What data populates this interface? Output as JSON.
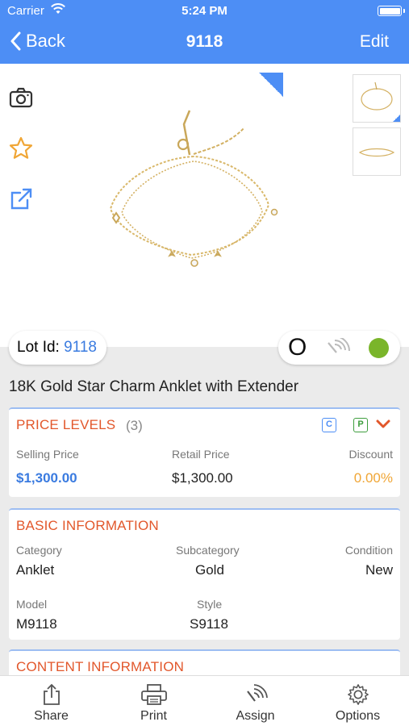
{
  "status": {
    "carrier": "Carrier",
    "time": "5:24 PM"
  },
  "nav": {
    "back_label": "Back",
    "title": "9118",
    "edit_label": "Edit"
  },
  "lot": {
    "label": "Lot Id:",
    "value": "9118"
  },
  "status_indicator": {
    "letter": "O",
    "dot_color": "#7ab52a"
  },
  "product": {
    "name": "18K Gold Star Charm Anklet with Extender"
  },
  "price_levels": {
    "title": "PRICE LEVELS",
    "count": "(3)",
    "badge_c": "C",
    "badge_p": "P",
    "selling_label": "Selling Price",
    "selling_value": "$1,300.00",
    "retail_label": "Retail Price",
    "retail_value": "$1,300.00",
    "discount_label": "Discount",
    "discount_value": "0.00%"
  },
  "basic_info": {
    "title": "BASIC INFORMATION",
    "category_label": "Category",
    "category_value": "Anklet",
    "subcategory_label": "Subcategory",
    "subcategory_value": "Gold",
    "condition_label": "Condition",
    "condition_value": "New",
    "model_label": "Model",
    "model_value": "M9118",
    "style_label": "Style",
    "style_value": "S9118"
  },
  "content_info": {
    "title": "CONTENT INFORMATION"
  },
  "tabs": [
    {
      "label": "Share",
      "icon": "share-icon"
    },
    {
      "label": "Print",
      "icon": "printer-icon"
    },
    {
      "label": "Assign",
      "icon": "rfid-icon"
    },
    {
      "label": "Options",
      "icon": "gear-icon"
    }
  ],
  "colors": {
    "accent": "#4d8ef5",
    "section_title": "#e2572b",
    "discount": "#f0a636",
    "selling": "#3a7be0"
  }
}
